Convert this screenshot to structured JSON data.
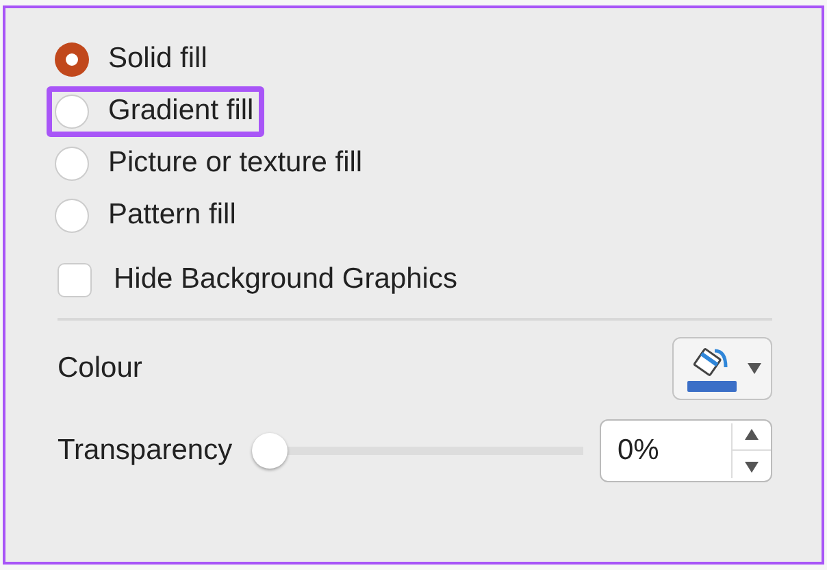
{
  "fill_options": [
    {
      "label": "Solid fill",
      "selected": true,
      "highlighted": false
    },
    {
      "label": "Gradient fill",
      "selected": false,
      "highlighted": true
    },
    {
      "label": "Picture or texture fill",
      "selected": false,
      "highlighted": false
    },
    {
      "label": "Pattern fill",
      "selected": false,
      "highlighted": false
    }
  ],
  "hide_background": {
    "label": "Hide Background Graphics",
    "checked": false
  },
  "colour": {
    "label": "Colour"
  },
  "transparency": {
    "label": "Transparency",
    "level": 0,
    "value": "0%"
  }
}
